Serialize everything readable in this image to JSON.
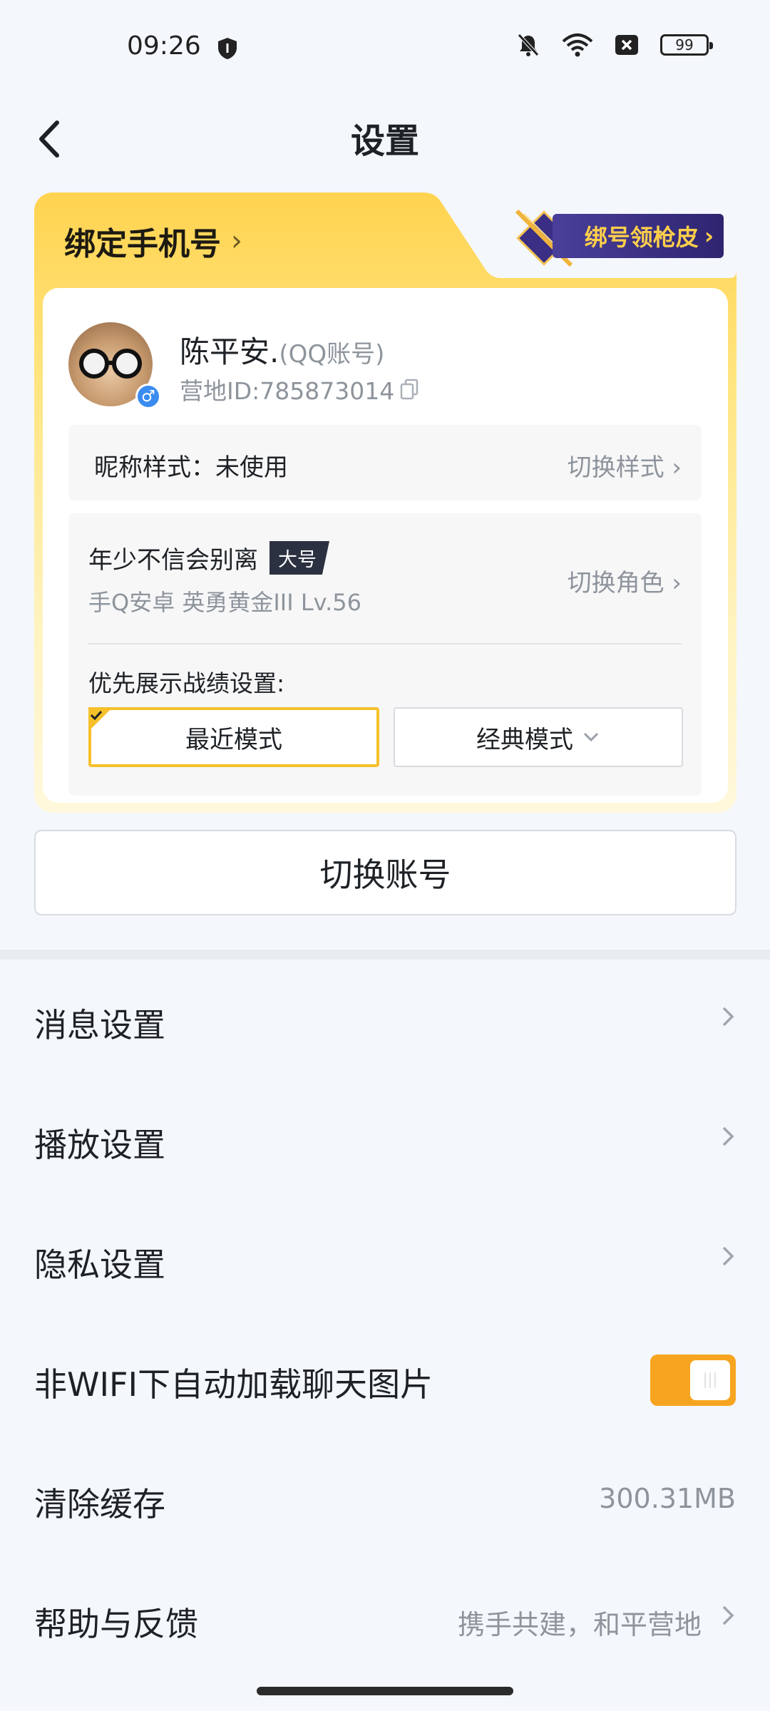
{
  "status_bar": {
    "time": "09:26",
    "battery": "99",
    "icons": [
      "shield-icon",
      "bell-off-icon",
      "wifi-icon",
      "sim-x-icon",
      "battery-icon"
    ]
  },
  "header": {
    "title": "设置"
  },
  "account_card": {
    "bind_phone_label": "绑定手机号",
    "bind_phone_chevron": "›",
    "promo_label": "绑号领枪皮",
    "promo_chevron": "›",
    "user": {
      "name": "陈平安.",
      "account_type": "(QQ账号)",
      "camp_id": "营地ID:785873014",
      "gender_symbol": "♂"
    },
    "nickname_style": {
      "label": "昵称样式：未使用",
      "action": "切换样式 ›"
    },
    "role": {
      "name": "年少不信会别离",
      "tag": "大号",
      "details": "手Q安卓  英勇黄金III  Lv.56",
      "action": "切换角色 ›"
    },
    "preference": {
      "label": "优先展示战绩设置:",
      "modes": [
        {
          "label": "最近模式",
          "selected": true
        },
        {
          "label": "经典模式",
          "selected": false
        }
      ]
    }
  },
  "switch_account_label": "切换账号",
  "settings": {
    "items": [
      {
        "label": "消息设置"
      },
      {
        "label": "播放设置"
      },
      {
        "label": "隐私设置"
      },
      {
        "label": "非WIFI下自动加载聊天图片",
        "toggle_on": true
      },
      {
        "label": "清除缓存",
        "value": "300.31MB"
      },
      {
        "label": "帮助与反馈",
        "value": "携手共建，和平营地"
      }
    ]
  },
  "colors": {
    "accent_orange": "#f7a521",
    "card_yellow": "#ffd34f",
    "selected_border": "#f6c02a",
    "promo_purple": "#3a2f85"
  }
}
